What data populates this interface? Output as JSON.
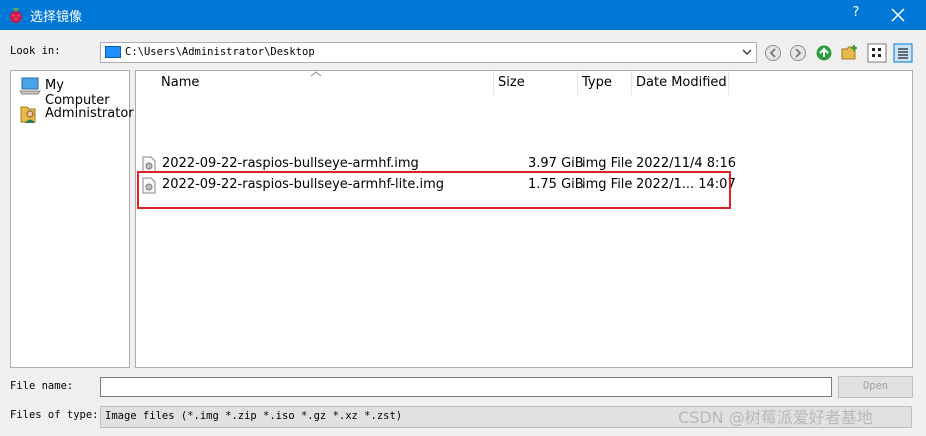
{
  "window": {
    "title": "选择镜像",
    "help_label": "?",
    "app_icon": "raspberry-icon",
    "accent": "#0078d7"
  },
  "look_in": {
    "label": "Look in:",
    "path": "C:\\Users\\Administrator\\Desktop"
  },
  "toolbar": [
    "back-icon",
    "forward-icon",
    "parent-folder-icon",
    "new-folder-icon",
    "list-view-icon",
    "detail-view-icon"
  ],
  "sidebar": {
    "items": [
      {
        "label": "My Computer",
        "icon": "computer-icon"
      },
      {
        "label": "Administrator",
        "icon": "user-folder-icon"
      }
    ]
  },
  "file_list": {
    "columns": [
      "Name",
      "Size",
      "Type",
      "Date Modified"
    ],
    "rows": [
      {
        "name": "2022-09-22-raspios-bullseye-armhf.img",
        "size": "3.97 GiB",
        "type": "img File",
        "date": "2022/11/4 8:16"
      },
      {
        "name": "2022-09-22-raspios-bullseye-armhf-lite.img",
        "size": "1.75 GiB",
        "type": "img File",
        "date": "2022/1... 14:07"
      }
    ],
    "highlight_color": "#d9252a"
  },
  "file_name": {
    "label": "File name:",
    "value": "",
    "open_label": "Open"
  },
  "file_type": {
    "label": "Files of type:",
    "value": "Image files (*.img *.zip *.iso *.gz *.xz *.zst)"
  },
  "watermark": "CSDN @树莓派爱好者基地"
}
